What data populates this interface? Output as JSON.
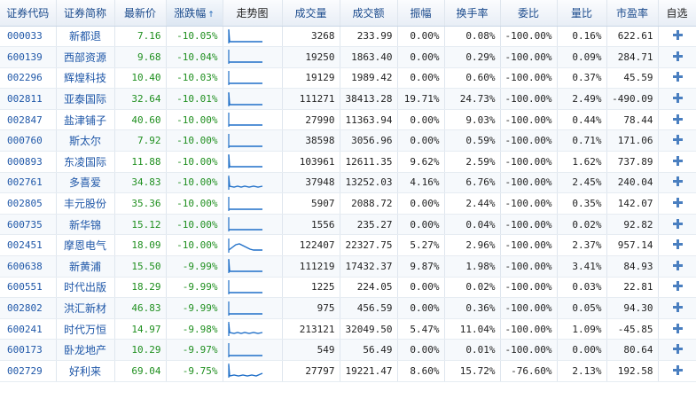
{
  "columns": [
    "证券代码",
    "证券简称",
    "最新价",
    "涨跌幅",
    "走势图",
    "成交量",
    "成交额",
    "振幅",
    "换手率",
    "委比",
    "量比",
    "市盈率",
    "自选"
  ],
  "sort_indicator": "↑",
  "rows": [
    {
      "code": "000033",
      "name": "新都退",
      "price": "7.16",
      "change": "-10.05%",
      "volume": "3268",
      "amount": "233.99",
      "amplitude": "0.00%",
      "turnover": "0.08%",
      "weibi": "-100.00%",
      "liangbi": "0.16%",
      "pe": "622.61",
      "spark": "drop-flat"
    },
    {
      "code": "600139",
      "name": "西部资源",
      "price": "9.68",
      "change": "-10.04%",
      "volume": "19250",
      "amount": "1863.40",
      "amplitude": "0.00%",
      "turnover": "0.29%",
      "weibi": "-100.00%",
      "liangbi": "0.09%",
      "pe": "284.71",
      "spark": "flat"
    },
    {
      "code": "002296",
      "name": "辉煌科技",
      "price": "10.40",
      "change": "-10.03%",
      "volume": "19129",
      "amount": "1989.42",
      "amplitude": "0.00%",
      "turnover": "0.60%",
      "weibi": "-100.00%",
      "liangbi": "0.37%",
      "pe": "45.59",
      "spark": "flat"
    },
    {
      "code": "002811",
      "name": "亚泰国际",
      "price": "32.64",
      "change": "-10.01%",
      "volume": "111271",
      "amount": "38413.28",
      "amplitude": "19.71%",
      "turnover": "24.73%",
      "weibi": "-100.00%",
      "liangbi": "2.49%",
      "pe": "-490.09",
      "spark": "drop-flat"
    },
    {
      "code": "002847",
      "name": "盐津铺子",
      "price": "40.60",
      "change": "-10.00%",
      "volume": "27990",
      "amount": "11363.94",
      "amplitude": "0.00%",
      "turnover": "9.03%",
      "weibi": "-100.00%",
      "liangbi": "0.44%",
      "pe": "78.44",
      "spark": "flat"
    },
    {
      "code": "000760",
      "name": "斯太尔",
      "price": "7.92",
      "change": "-10.00%",
      "volume": "38598",
      "amount": "3056.96",
      "amplitude": "0.00%",
      "turnover": "0.59%",
      "weibi": "-100.00%",
      "liangbi": "0.71%",
      "pe": "171.06",
      "spark": "flat"
    },
    {
      "code": "000893",
      "name": "东凌国际",
      "price": "11.88",
      "change": "-10.00%",
      "volume": "103961",
      "amount": "12611.35",
      "amplitude": "9.62%",
      "turnover": "2.59%",
      "weibi": "-100.00%",
      "liangbi": "1.62%",
      "pe": "737.89",
      "spark": "drop-flat"
    },
    {
      "code": "002761",
      "name": "多喜爱",
      "price": "34.83",
      "change": "-10.00%",
      "volume": "37948",
      "amount": "13252.03",
      "amplitude": "4.16%",
      "turnover": "6.76%",
      "weibi": "-100.00%",
      "liangbi": "2.45%",
      "pe": "240.04",
      "spark": "wiggle-low"
    },
    {
      "code": "002805",
      "name": "丰元股份",
      "price": "35.36",
      "change": "-10.00%",
      "volume": "5907",
      "amount": "2088.72",
      "amplitude": "0.00%",
      "turnover": "2.44%",
      "weibi": "-100.00%",
      "liangbi": "0.35%",
      "pe": "142.07",
      "spark": "flat"
    },
    {
      "code": "600735",
      "name": "新华锦",
      "price": "15.12",
      "change": "-10.00%",
      "volume": "1556",
      "amount": "235.27",
      "amplitude": "0.00%",
      "turnover": "0.04%",
      "weibi": "-100.00%",
      "liangbi": "0.02%",
      "pe": "92.82",
      "spark": "flat"
    },
    {
      "code": "002451",
      "name": "摩恩电气",
      "price": "18.09",
      "change": "-10.00%",
      "volume": "122407",
      "amount": "22327.75",
      "amplitude": "5.27%",
      "turnover": "2.96%",
      "weibi": "-100.00%",
      "liangbi": "2.37%",
      "pe": "957.14",
      "spark": "hump"
    },
    {
      "code": "600638",
      "name": "新黄浦",
      "price": "15.50",
      "change": "-9.99%",
      "volume": "111219",
      "amount": "17432.37",
      "amplitude": "9.87%",
      "turnover": "1.98%",
      "weibi": "-100.00%",
      "liangbi": "3.41%",
      "pe": "84.93",
      "spark": "drop-flat"
    },
    {
      "code": "600551",
      "name": "时代出版",
      "price": "18.29",
      "change": "-9.99%",
      "volume": "1225",
      "amount": "224.05",
      "amplitude": "0.00%",
      "turnover": "0.02%",
      "weibi": "-100.00%",
      "liangbi": "0.03%",
      "pe": "22.81",
      "spark": "flat"
    },
    {
      "code": "002802",
      "name": "洪汇新材",
      "price": "46.83",
      "change": "-9.99%",
      "volume": "975",
      "amount": "456.59",
      "amplitude": "0.00%",
      "turnover": "0.36%",
      "weibi": "-100.00%",
      "liangbi": "0.05%",
      "pe": "94.30",
      "spark": "flat"
    },
    {
      "code": "600241",
      "name": "时代万恒",
      "price": "14.97",
      "change": "-9.98%",
      "volume": "213121",
      "amount": "32049.50",
      "amplitude": "5.47%",
      "turnover": "11.04%",
      "weibi": "-100.00%",
      "liangbi": "1.09%",
      "pe": "-45.85",
      "spark": "wiggle-low"
    },
    {
      "code": "600173",
      "name": "卧龙地产",
      "price": "10.29",
      "change": "-9.97%",
      "volume": "549",
      "amount": "56.49",
      "amplitude": "0.00%",
      "turnover": "0.01%",
      "weibi": "-100.00%",
      "liangbi": "0.00%",
      "pe": "80.64",
      "spark": "flat"
    },
    {
      "code": "002729",
      "name": "好利来",
      "price": "69.04",
      "change": "-9.75%",
      "volume": "27797",
      "amount": "19221.47",
      "amplitude": "8.60%",
      "turnover": "15.72%",
      "weibi": "-76.60%",
      "liangbi": "2.13%",
      "pe": "192.58",
      "spark": "drop-wiggle"
    }
  ],
  "colors": {
    "header_text": "#1a4a8c",
    "code_text": "#1f57a8",
    "down": "#1f8f1f",
    "spark": "#1f6fc8",
    "plus_icon": "#4a7fc0"
  }
}
